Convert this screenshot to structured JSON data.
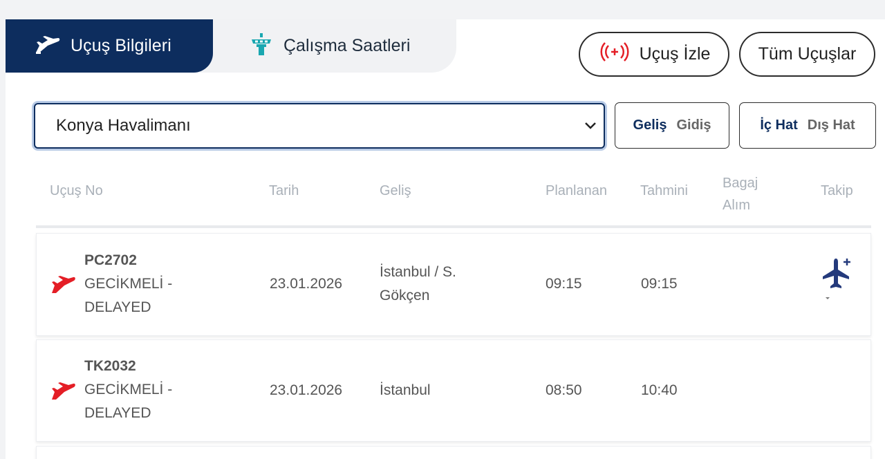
{
  "tabs": {
    "flight_info": "Uçuş Bilgileri",
    "working_hours": "Çalışma Saatleri"
  },
  "buttons": {
    "live": "Uçuş İzle",
    "all_flights": "Tüm Uçuşlar"
  },
  "airport_select": {
    "value": "Konya Havalimanı"
  },
  "direction_toggle": {
    "arrival": "Geliş",
    "departure": "Gidiş",
    "selected": "Geliş"
  },
  "type_toggle": {
    "domestic": "İç Hat",
    "international": "Dış Hat",
    "selected": "İç Hat"
  },
  "table": {
    "headers": {
      "flight_no": "Uçuş No",
      "date": "Tarih",
      "arrival": "Geliş",
      "planned": "Planlanan",
      "estimated": "Tahmini",
      "baggage_line1": "Bagaj",
      "baggage_line2": "Alım",
      "track": "Takip"
    },
    "rows": [
      {
        "code": "PC2702",
        "status_line1": "GECİKMELİ -",
        "status_line2": "DELAYED",
        "date": "23.01.2026",
        "from_line1": "İstanbul / S.",
        "from_line2": "Gökçen",
        "planned": "09:15",
        "estimated": "09:15",
        "baggage": ""
      },
      {
        "code": "TK2032",
        "status_line1": "GECİKMELİ -",
        "status_line2": "DELAYED",
        "date": "23.01.2026",
        "from_line1": "İstanbul",
        "from_line2": "",
        "planned": "08:50",
        "estimated": "10:40",
        "baggage": ""
      }
    ]
  },
  "colors": {
    "navy": "#0d2d5e",
    "red": "#e41e26",
    "teal": "#1aa7b0",
    "muted": "#a9b0b8"
  },
  "icons": {
    "tab1": "airplane-icon",
    "tab2": "control-tower-icon",
    "live": "broadcast-icon",
    "status": "red-plane-icon",
    "track": "plane-plus-icon"
  }
}
